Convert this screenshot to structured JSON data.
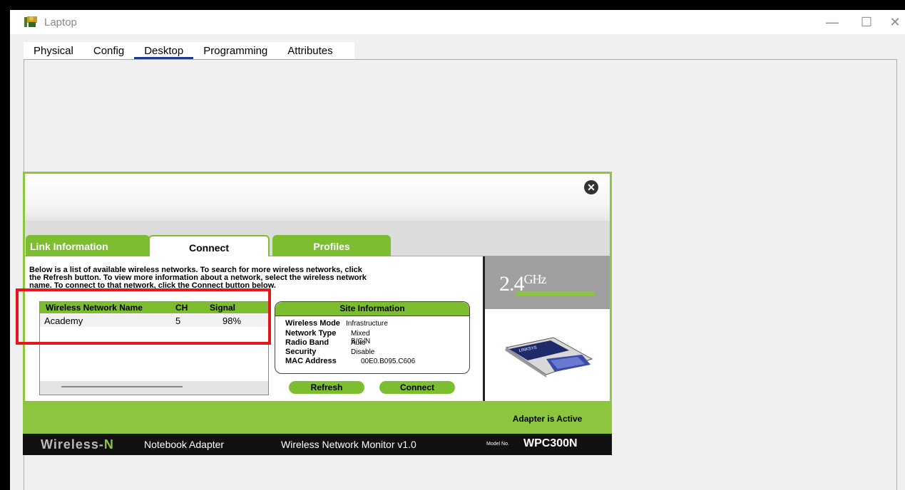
{
  "window": {
    "title": "Laptop",
    "minimize": "—",
    "maximize": "☐",
    "close": "✕"
  },
  "tabs": [
    "Physical",
    "Config",
    "Desktop",
    "Programming",
    "Attributes"
  ],
  "dialog": {
    "tabs": {
      "link_info": "Link Information",
      "connect": "Connect",
      "profiles": "Profiles"
    },
    "description_1": "Below is a list of available wireless networks. To search for more wireless networks, click",
    "description_2a": "the ",
    "description_2b": "Refresh",
    "description_2c": " button. To view more information about a network, select the wireless network",
    "description_3a": "name. To connect to that network, click the ",
    "description_3b": "Connect",
    "description_3c": " button below.",
    "network_list": {
      "headers": {
        "name": "Wireless Network Name",
        "ch": "CH",
        "signal": "Signal"
      },
      "rows": [
        {
          "name": "Academy",
          "ch": "5",
          "signal": "98%"
        }
      ]
    },
    "site_info": {
      "title": "Site Information",
      "wireless_mode_label": "Wireless Mode",
      "wireless_mode": "Infrastructure",
      "network_type_label": "Network Type",
      "network_type": "Mixed B/G/N",
      "radio_band_label": "Radio Band",
      "radio_band": "Auto",
      "security_label": "Security",
      "security": "Disable",
      "mac_label": "MAC Address",
      "mac": "00E0.B095.C606"
    },
    "refresh_button": "Refresh",
    "connect_button": "Connect",
    "ghz": "2.4",
    "ghz_unit": "GHz",
    "adapter_status": "Adapter is Active",
    "footer": {
      "brand_a": "Wireless-",
      "brand_b": "N",
      "product": "Notebook Adapter",
      "monitor": "Wireless Network Monitor  v1.0",
      "model_label": "Model No.",
      "model": "WPC300N"
    }
  },
  "colors": {
    "green": "#8bc63e",
    "highlight": "#e3171c"
  }
}
